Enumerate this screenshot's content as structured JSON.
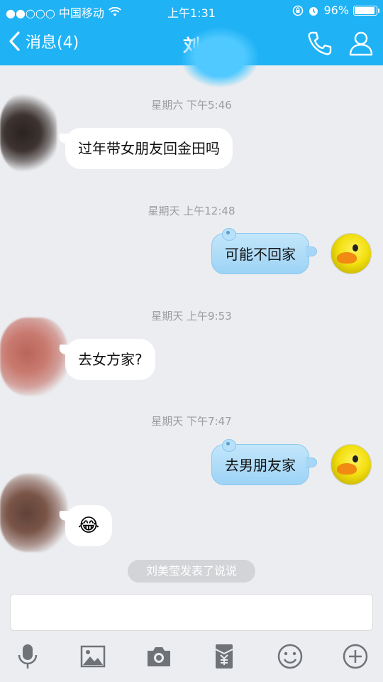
{
  "status_bar": {
    "carrier": "●●○○○ 中国移动",
    "time": "上午1:31",
    "battery": "96%",
    "battery_level": 0.96
  },
  "nav": {
    "back_label": "消息(4)",
    "title": "刘"
  },
  "messages": [
    {
      "timestamp": "星期六 下午5:46",
      "side": "left",
      "text": "过年带女朋友回金田吗"
    },
    {
      "timestamp": "星期天 上午12:48",
      "side": "right",
      "text": "可能不回家"
    },
    {
      "timestamp": "星期天 上午9:53",
      "side": "left",
      "text": "去女方家?"
    },
    {
      "timestamp": "星期天 下午7:47",
      "side": "right",
      "text": "去男朋友家"
    },
    {
      "timestamp": "",
      "side": "left",
      "text": "😂"
    }
  ],
  "notice": "刘美莹发表了说说",
  "input": {
    "value": ""
  },
  "toolbar": [
    "mic-icon",
    "image-icon",
    "camera-icon",
    "red-packet-icon",
    "emoji-icon",
    "plus-icon"
  ],
  "colors": {
    "accent": "#1fb2f5",
    "background": "#ebedf0",
    "bubble_right": "#a6d7f7"
  }
}
